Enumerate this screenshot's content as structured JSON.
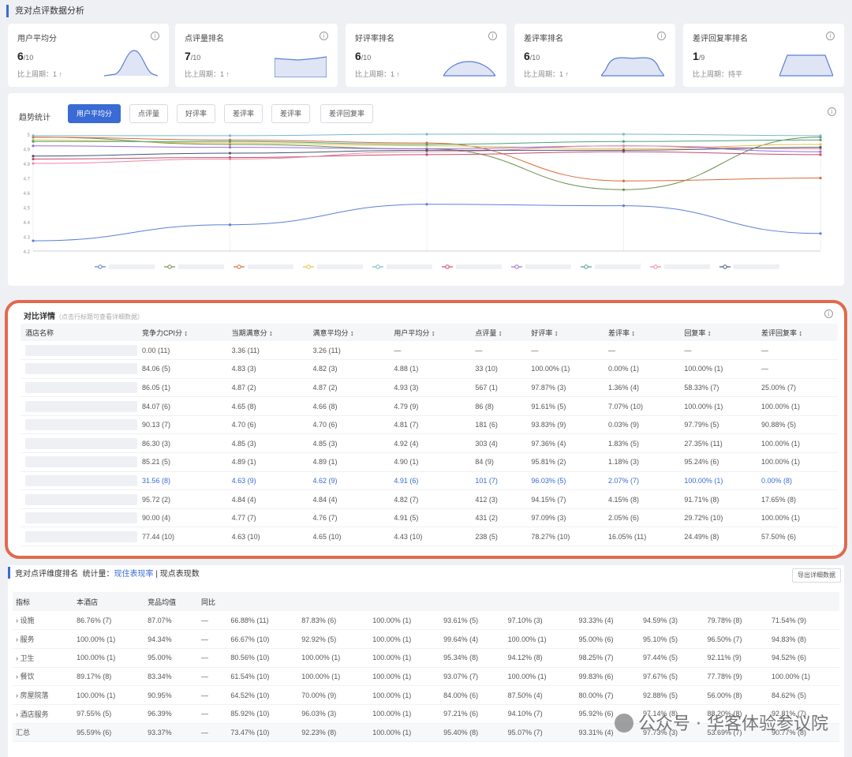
{
  "page_title": "竞对点评数据分析",
  "kpis": [
    {
      "title": "用户平均分",
      "value": "6",
      "total": "/10",
      "cmp": "比上周期：1 ↑"
    },
    {
      "title": "点评量排名",
      "value": "7",
      "total": "/10",
      "cmp": "比上周期：1 ↑"
    },
    {
      "title": "好评率排名",
      "value": "6",
      "total": "/10",
      "cmp": "比上周期：1 ↑"
    },
    {
      "title": "差评率排名",
      "value": "6",
      "total": "/10",
      "cmp": "比上周期：1 ↑"
    },
    {
      "title": "差评回复率排名",
      "value": "1",
      "total": "/9",
      "cmp": "比上周期：持平"
    }
  ],
  "trend": {
    "label": "趋势统计",
    "buttons": [
      "用户平均分",
      "点评量",
      "好评率",
      "差评率",
      "差评率",
      "差评回复率"
    ],
    "active": 0,
    "y_ticks": [
      "5",
      "4.9",
      "4.8",
      "4.7",
      "4.6",
      "4.5",
      "4.4",
      "4.3",
      "4.2"
    ]
  },
  "chart_data": {
    "type": "line",
    "ylim": [
      4.2,
      5.0
    ],
    "x": [
      "1",
      "2",
      "3",
      "4",
      "5"
    ],
    "series": [
      {
        "color": "#5b7fd6",
        "values": [
          4.27,
          4.38,
          4.52,
          4.51,
          4.32
        ]
      },
      {
        "color": "#6b8f4e",
        "values": [
          4.98,
          4.93,
          4.9,
          4.62,
          4.98
        ]
      },
      {
        "color": "#d96b3a",
        "values": [
          4.98,
          4.96,
          4.94,
          4.68,
          4.7
        ]
      },
      {
        "color": "#e5c24a",
        "values": [
          4.96,
          4.94,
          4.92,
          4.9,
          4.93
        ]
      },
      {
        "color": "#7ab8c9",
        "values": [
          4.99,
          4.99,
          5.0,
          5.0,
          4.99
        ]
      },
      {
        "color": "#c94a6a",
        "values": [
          4.83,
          4.84,
          4.86,
          4.88,
          4.86
        ]
      },
      {
        "color": "#9b6bd4",
        "values": [
          4.92,
          4.91,
          4.9,
          4.92,
          4.88
        ]
      },
      {
        "color": "#4aa37a",
        "values": [
          4.95,
          4.95,
          4.93,
          4.95,
          4.96
        ]
      },
      {
        "color": "#e88aa0",
        "values": [
          4.8,
          4.83,
          4.88,
          4.92,
          4.9
        ]
      },
      {
        "color": "#445577",
        "values": [
          4.85,
          4.87,
          4.89,
          4.89,
          4.91
        ]
      }
    ]
  },
  "compare": {
    "title": "对比详情",
    "subtitle": "（点击行标题可查看详细数据）",
    "headers": [
      "酒店名称",
      "竞争力CPI分",
      "当期满意分",
      "满意平均分",
      "用户平均分",
      "点评量",
      "好评率",
      "差评率",
      "回复率",
      "差评回复率"
    ],
    "rows": [
      [
        "",
        "0.00 (11)",
        "3.36 (11)",
        "3.26 (11)",
        "—",
        "—",
        "—",
        "—",
        "—",
        "—"
      ],
      [
        "",
        "84.06 (5)",
        "4.83 (3)",
        "4.82 (3)",
        "4.88 (1)",
        "33 (10)",
        "100.00% (1)",
        "0.00% (1)",
        "100.00% (1)",
        "—"
      ],
      [
        "",
        "86.05 (1)",
        "4.87 (2)",
        "4.87 (2)",
        "4.93 (3)",
        "567 (1)",
        "97.87% (3)",
        "1.36% (4)",
        "58.33% (7)",
        "25.00% (7)"
      ],
      [
        "",
        "84.07 (6)",
        "4.65 (8)",
        "4.66 (8)",
        "4.79 (9)",
        "86 (8)",
        "91.61% (5)",
        "7.07% (10)",
        "100.00% (1)",
        "100.00% (1)"
      ],
      [
        "",
        "90.13 (7)",
        "4.70 (6)",
        "4.70 (6)",
        "4.81 (7)",
        "181 (6)",
        "93.83% (9)",
        "0.03% (9)",
        "97.79% (5)",
        "90.88% (5)"
      ],
      [
        "",
        "86.30 (3)",
        "4.85 (3)",
        "4.85 (3)",
        "4.92 (4)",
        "303 (4)",
        "97.36% (4)",
        "1.83% (5)",
        "27.35% (11)",
        "100.00% (1)"
      ],
      [
        "",
        "85.21 (5)",
        "4.89 (1)",
        "4.89 (1)",
        "4.90 (1)",
        "84 (9)",
        "95.81% (2)",
        "1.18% (3)",
        "95.24% (6)",
        "100.00% (1)"
      ],
      [
        "",
        "31.56 (8)",
        "4.63 (9)",
        "4.62 (9)",
        "4.91 (6)",
        "101 (7)",
        "96.03% (5)",
        "2.07% (7)",
        "100.00% (1)",
        "0.00% (8)"
      ],
      [
        "",
        "95.72 (2)",
        "4.84 (4)",
        "4.84 (4)",
        "4.82 (7)",
        "412 (3)",
        "94.15% (7)",
        "4.15% (8)",
        "91.71% (8)",
        "17.65% (8)"
      ],
      [
        "",
        "90.00 (4)",
        "4.77 (7)",
        "4.76 (7)",
        "4.91 (5)",
        "431 (2)",
        "97.09% (3)",
        "2.05% (6)",
        "29.72% (10)",
        "100.00% (1)"
      ],
      [
        "",
        "77.44 (10)",
        "4.63 (10)",
        "4.65 (10)",
        "4.43 (10)",
        "238 (5)",
        "78.27% (10)",
        "16.05% (11)",
        "24.49% (8)",
        "57.50% (6)"
      ]
    ],
    "highlight_row": 7
  },
  "rank": {
    "title": "竞对点评维度排名",
    "filter_label": "统计量：",
    "link_a": "现住表现率",
    "link_b": "现点表现数",
    "export": "导出详细数据",
    "headers": [
      "指标",
      "本酒店",
      "竞品均值",
      "同比",
      "",
      "",
      "",
      "",
      "",
      "",
      "",
      "",
      "",
      ""
    ],
    "rows": [
      [
        "› 设施",
        "86.76% (7)",
        "87.07%",
        "—",
        "66.88% (11)",
        "87.83% (6)",
        "100.00% (1)",
        "93.61% (5)",
        "97.10% (3)",
        "93.33% (4)",
        "94.59% (3)",
        "79.78% (8)",
        "71.54% (9)"
      ],
      [
        "› 服务",
        "100.00% (1)",
        "94.34%",
        "—",
        "66.67% (10)",
        "92.92% (5)",
        "100.00% (1)",
        "99.64% (4)",
        "100.00% (1)",
        "95.00% (6)",
        "95.10% (5)",
        "96.50% (7)",
        "94.83% (8)"
      ],
      [
        "› 卫生",
        "100.00% (1)",
        "95.00%",
        "—",
        "80.56% (10)",
        "100.00% (1)",
        "100.00% (1)",
        "95.34% (8)",
        "94.12% (8)",
        "98.25% (7)",
        "97.44% (5)",
        "92.11% (9)",
        "94.52% (6)"
      ],
      [
        "› 餐饮",
        "89.17% (8)",
        "83.34%",
        "—",
        "61.54% (10)",
        "100.00% (1)",
        "100.00% (1)",
        "93.07% (7)",
        "100.00% (1)",
        "99.83% (6)",
        "97.67% (5)",
        "77.78% (9)",
        "100.00% (1)"
      ],
      [
        "› 房屋院落",
        "100.00% (1)",
        "90.95%",
        "—",
        "64.52% (10)",
        "70.00% (9)",
        "100.00% (1)",
        "84.00% (6)",
        "87.50% (4)",
        "80.00% (7)",
        "92.88% (5)",
        "56.00% (8)",
        "84.62% (5)"
      ],
      [
        "› 酒店服务",
        "97.55% (5)",
        "96.39%",
        "—",
        "85.92% (10)",
        "96.03% (3)",
        "100.00% (1)",
        "97.21% (6)",
        "94.10% (7)",
        "95.92% (6)",
        "97.14% (8)",
        "88.20% (8)",
        "92.81% (7)"
      ],
      [
        "汇总",
        "95.59% (6)",
        "93.37%",
        "—",
        "73.47% (10)",
        "92.23% (8)",
        "100.00% (1)",
        "95.40% (8)",
        "95.07% (7)",
        "93.31% (4)",
        "97.73% (3)",
        "53.69% (7)",
        "90.77% (8)"
      ]
    ]
  },
  "watermark": "公众号 · 华客体验参议院"
}
